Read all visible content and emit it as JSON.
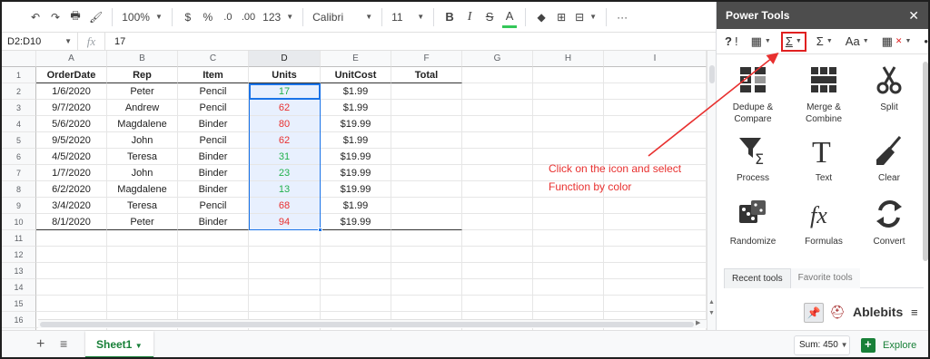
{
  "toolbar": {
    "undo_icon": "undo-icon",
    "redo_icon": "redo-icon",
    "zoom": "100%",
    "currency": "$",
    "percent": "%",
    "dec_decrease": ".0",
    "dec_increase": ".00",
    "more_formats": "123",
    "font": "Calibri",
    "font_size": "11",
    "bold": "B",
    "italic": "I",
    "strike": "S",
    "text_color": "A",
    "more": "···"
  },
  "formula_bar": {
    "name_box": "D2:D10",
    "fx": "fx",
    "value": "17"
  },
  "grid": {
    "columns": [
      "A",
      "B",
      "C",
      "D",
      "E",
      "F",
      "G",
      "H",
      "I"
    ],
    "rows": [
      "1",
      "2",
      "3",
      "4",
      "5",
      "6",
      "7",
      "8",
      "9",
      "10",
      "11",
      "12",
      "13",
      "14",
      "15",
      "16",
      "17"
    ],
    "headers": [
      "OrderDate",
      "Rep",
      "Item",
      "Units",
      "UnitCost",
      "Total"
    ],
    "data": [
      [
        "1/6/2020",
        "Peter",
        "Pencil",
        "17",
        "$1.99"
      ],
      [
        "9/7/2020",
        "Andrew",
        "Pencil",
        "62",
        "$1.99"
      ],
      [
        "5/6/2020",
        "Magdalene",
        "Binder",
        "80",
        "$19.99"
      ],
      [
        "9/5/2020",
        "John",
        "Pencil",
        "62",
        "$1.99"
      ],
      [
        "4/5/2020",
        "Teresa",
        "Binder",
        "31",
        "$19.99"
      ],
      [
        "1/7/2020",
        "John",
        "Binder",
        "23",
        "$19.99"
      ],
      [
        "6/2/2020",
        "Magdalene",
        "Binder",
        "13",
        "$19.99"
      ],
      [
        "3/4/2020",
        "Teresa",
        "Pencil",
        "68",
        "$1.99"
      ],
      [
        "8/1/2020",
        "Peter",
        "Binder",
        "94",
        "$19.99"
      ]
    ],
    "unit_colors": [
      "green",
      "red",
      "red",
      "red",
      "green",
      "green",
      "green",
      "red",
      "red"
    ]
  },
  "bottom": {
    "add_sheet": "+",
    "all_sheets": "≡",
    "sheet_tab": "Sheet1",
    "sum": "Sum: 450",
    "explore": "Explore"
  },
  "panel": {
    "title": "Power Tools",
    "close": "✕",
    "tools": [
      {
        "name": "Dedupe & Compare",
        "icon": "dedupe-icon"
      },
      {
        "name": "Merge & Combine",
        "icon": "merge-icon"
      },
      {
        "name": "Split",
        "icon": "scissors-icon"
      },
      {
        "name": "Process",
        "icon": "process-icon"
      },
      {
        "name": "Text",
        "icon": "text-icon"
      },
      {
        "name": "Clear",
        "icon": "broom-icon"
      },
      {
        "name": "Randomize",
        "icon": "dice-icon"
      },
      {
        "name": "Formulas",
        "icon": "fx-icon"
      },
      {
        "name": "Convert",
        "icon": "convert-icon"
      }
    ],
    "tabs": [
      "Recent tools",
      "Favorite tools"
    ],
    "brand": "Ablebits"
  },
  "annotation": {
    "line1": "Click on the icon and select",
    "line2": "Function by color"
  },
  "colors": {
    "green": "#22b14c",
    "red": "#e8302f",
    "selection": "#1a73e8",
    "annotation": "#e8302f"
  }
}
